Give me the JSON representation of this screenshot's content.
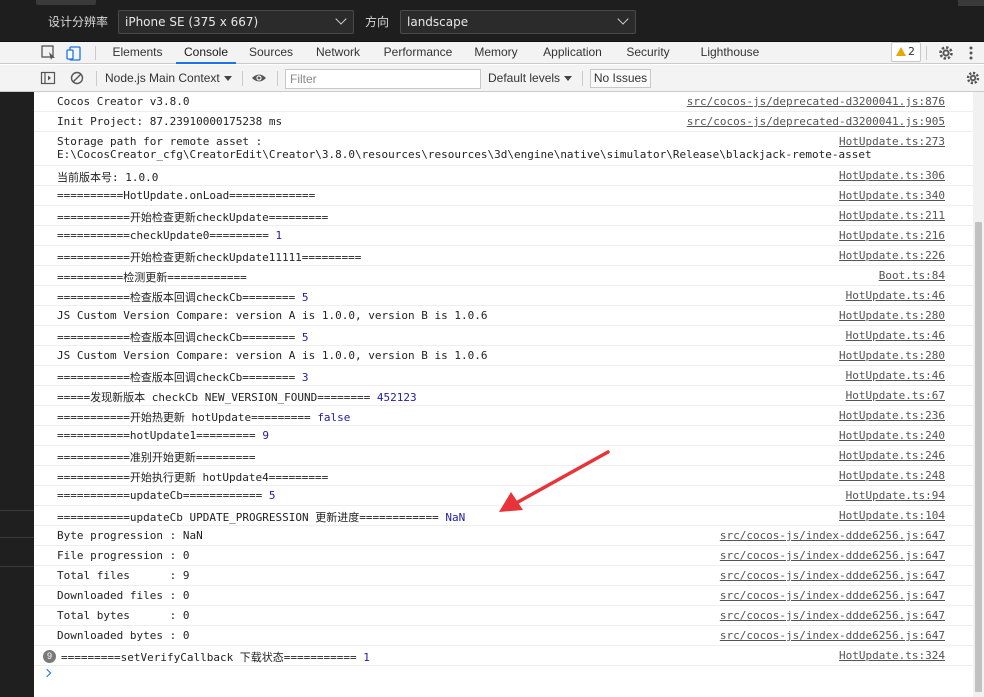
{
  "device_toolbar": {
    "resolution_label": "设计分辨率",
    "device_value": "iPhone SE (375 x 667)",
    "orientation_label": "方向",
    "orientation_value": "landscape"
  },
  "tabs": [
    {
      "label": "Elements",
      "active": false
    },
    {
      "label": "Console",
      "active": true
    },
    {
      "label": "Sources",
      "active": false
    },
    {
      "label": "Network",
      "active": false
    },
    {
      "label": "Performance",
      "active": false
    },
    {
      "label": "Memory",
      "active": false
    },
    {
      "label": "Application",
      "active": false
    },
    {
      "label": "Security",
      "active": false
    },
    {
      "label": "Lighthouse",
      "active": false
    }
  ],
  "warning_count": "2",
  "console_toolbar": {
    "context": "Node.js Main Context",
    "filter_placeholder": "Filter",
    "levels": "Default levels",
    "issues": "No Issues"
  },
  "logs": [
    {
      "msg": "Cocos Creator v3.8.0",
      "src": "src/cocos-js/deprecated-d3200041.js:876"
    },
    {
      "msg": "Init Project: 87.23910000175238 ms",
      "src": "src/cocos-js/deprecated-d3200041.js:905"
    },
    {
      "msg": "Storage path for remote asset :",
      "msg2": "E:\\CocosCreator_cfg\\CreatorEdit\\Creator\\3.8.0\\resources\\resources\\3d\\engine\\native\\simulator\\Release\\blackjack-remote-asset",
      "src": "HotUpdate.ts:273"
    },
    {
      "msg": "当前版本号: 1.0.0",
      "src": "HotUpdate.ts:306"
    },
    {
      "msg": "==========HotUpdate.onLoad=============",
      "src": "HotUpdate.ts:340"
    },
    {
      "msg": "===========开始检查更新checkUpdate=========",
      "src": "HotUpdate.ts:211"
    },
    {
      "msg": "===========checkUpdate0========= ",
      "val": "1",
      "src": "HotUpdate.ts:216"
    },
    {
      "msg": "===========开始检查更新checkUpdate11111=========",
      "src": "HotUpdate.ts:226"
    },
    {
      "msg": "==========检测更新============",
      "src": "Boot.ts:84"
    },
    {
      "msg": "===========检查版本回调checkCb======== ",
      "val": "5",
      "src": "HotUpdate.ts:46"
    },
    {
      "msg": "JS Custom Version Compare: version A is 1.0.0, version B is 1.0.6",
      "src": "HotUpdate.ts:280"
    },
    {
      "msg": "===========检查版本回调checkCb======== ",
      "val": "5",
      "src": "HotUpdate.ts:46"
    },
    {
      "msg": "JS Custom Version Compare: version A is 1.0.0, version B is 1.0.6",
      "src": "HotUpdate.ts:280"
    },
    {
      "msg": "===========检查版本回调checkCb======== ",
      "val": "3",
      "src": "HotUpdate.ts:46"
    },
    {
      "msg": "=====发现新版本 checkCb NEW_VERSION_FOUND======== ",
      "val": "452123",
      "src": "HotUpdate.ts:67"
    },
    {
      "msg": "===========开始热更新 hotUpdate========= ",
      "val": "false",
      "src": "HotUpdate.ts:236"
    },
    {
      "msg": "===========hotUpdate1========= ",
      "val": "9",
      "src": "HotUpdate.ts:240"
    },
    {
      "msg": "===========准别开始更新=========",
      "src": "HotUpdate.ts:246"
    },
    {
      "msg": "===========开始执行更新 hotUpdate4=========",
      "src": "HotUpdate.ts:248"
    },
    {
      "msg": "===========updateCb============ ",
      "val": "5",
      "src": "HotUpdate.ts:94"
    },
    {
      "msg": "===========updateCb UPDATE_PROGRESSION 更新进度============ ",
      "val": "NaN",
      "src": "HotUpdate.ts:104"
    },
    {
      "msg": "Byte progression : NaN",
      "src": "src/cocos-js/index-ddde6256.js:647"
    },
    {
      "msg": "File progression : 0",
      "src": "src/cocos-js/index-ddde6256.js:647"
    },
    {
      "msg": "Total files      : 9",
      "src": "src/cocos-js/index-ddde6256.js:647"
    },
    {
      "msg": "Downloaded files : 0",
      "src": "src/cocos-js/index-ddde6256.js:647"
    },
    {
      "msg": "Total bytes      : 0",
      "src": "src/cocos-js/index-ddde6256.js:647"
    },
    {
      "msg": "Downloaded bytes : 0",
      "src": "src/cocos-js/index-ddde6256.js:647"
    },
    {
      "msg": "=========setVerifyCallback 下载状态=========== ",
      "val": "1",
      "src": "HotUpdate.ts:324",
      "repeat": "9"
    }
  ],
  "colors": {
    "accent": "#1a73e8",
    "arrow": "#e8333a",
    "value": "#1c1ca6"
  }
}
